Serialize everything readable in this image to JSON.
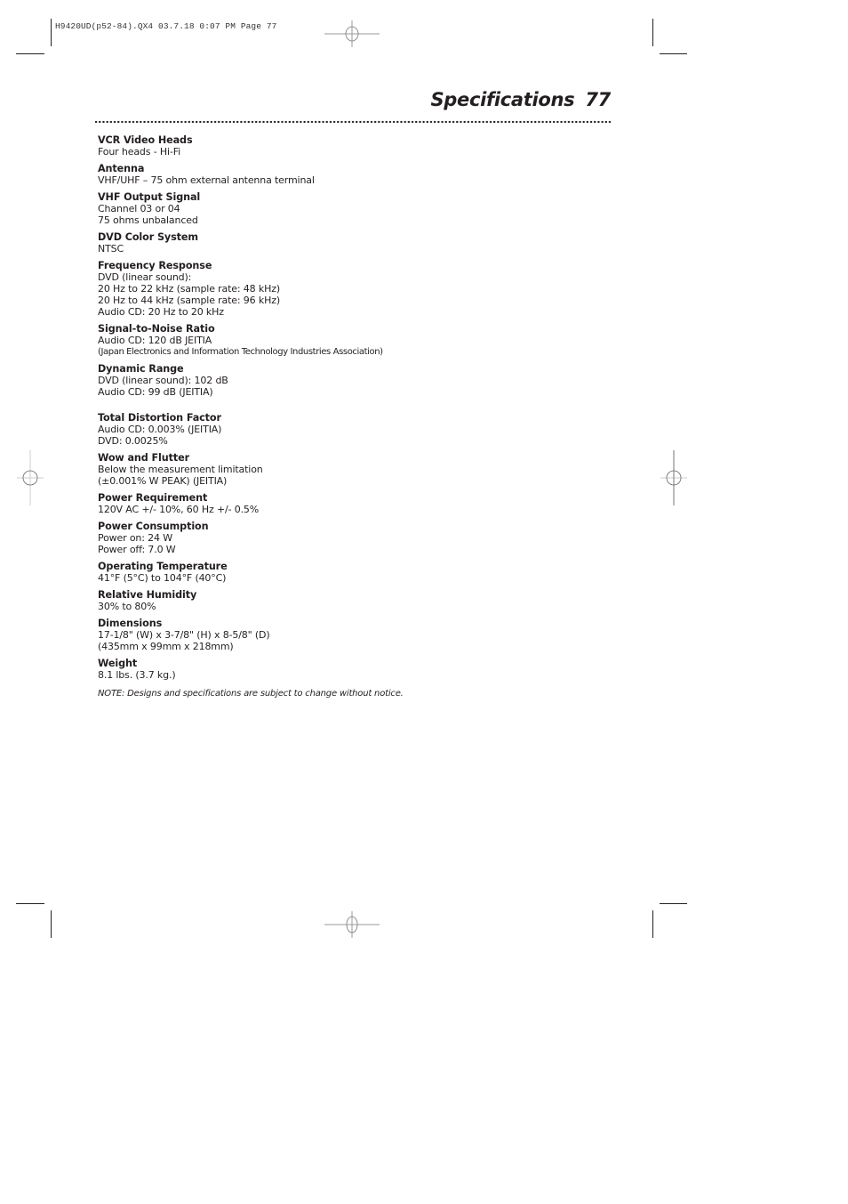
{
  "slug": "H9420UD(p52-84).QX4  03.7.18  0:07 PM  Page 77",
  "header": {
    "title": "Specifications",
    "page_number": "77"
  },
  "specs": [
    {
      "heading": "VCR Video Heads",
      "lines": [
        "Four heads - Hi-Fi"
      ]
    },
    {
      "heading": "Antenna",
      "lines": [
        "VHF/UHF – 75 ohm external antenna terminal"
      ]
    },
    {
      "heading": "VHF Output Signal",
      "lines": [
        "Channel 03 or 04",
        "75 ohms unbalanced"
      ]
    },
    {
      "heading": "DVD Color System",
      "lines": [
        "NTSC"
      ]
    },
    {
      "heading": "Frequency Response",
      "lines": [
        "DVD (linear sound):",
        "20 Hz to 22 kHz (sample rate: 48 kHz)",
        "20 Hz to 44 kHz (sample rate: 96 kHz)",
        "Audio CD: 20 Hz to 20 kHz"
      ]
    },
    {
      "heading": "Signal-to-Noise Ratio",
      "lines": [
        "Audio CD: 120 dB JEITIA"
      ],
      "small_lines": [
        "(Japan Electronics and Information Technology Industries Association)"
      ]
    },
    {
      "heading": "Dynamic Range",
      "lines": [
        "DVD (linear sound): 102 dB",
        "Audio CD: 99 dB (JEITIA)"
      ]
    },
    {
      "heading": "Total Distortion Factor",
      "lines": [
        "Audio CD: 0.003% (JEITIA)",
        "DVD: 0.0025%"
      ]
    },
    {
      "heading": "Wow and Flutter",
      "lines": [
        "Below the measurement limitation",
        "(±0.001% W PEAK) (JEITIA)"
      ]
    },
    {
      "heading": "Power Requirement",
      "lines": [
        "120V AC +/- 10%, 60 Hz +/- 0.5%"
      ]
    },
    {
      "heading": "Power Consumption",
      "lines": [
        "Power on: 24 W",
        "Power off: 7.0 W"
      ]
    },
    {
      "heading": "Operating Temperature",
      "lines": [
        "41°F (5°C) to 104°F (40°C)"
      ]
    },
    {
      "heading": "Relative Humidity",
      "lines": [
        "30% to 80%"
      ]
    },
    {
      "heading": "Dimensions",
      "lines": [
        "17-1/8\" (W) x 3-7/8\" (H) x 8-5/8\" (D)",
        "(435mm x 99mm x 218mm)"
      ]
    },
    {
      "heading": "Weight",
      "lines": [
        "8.1 lbs. (3.7 kg.)"
      ]
    }
  ],
  "note": "NOTE: Designs and specifications are subject to change without notice."
}
